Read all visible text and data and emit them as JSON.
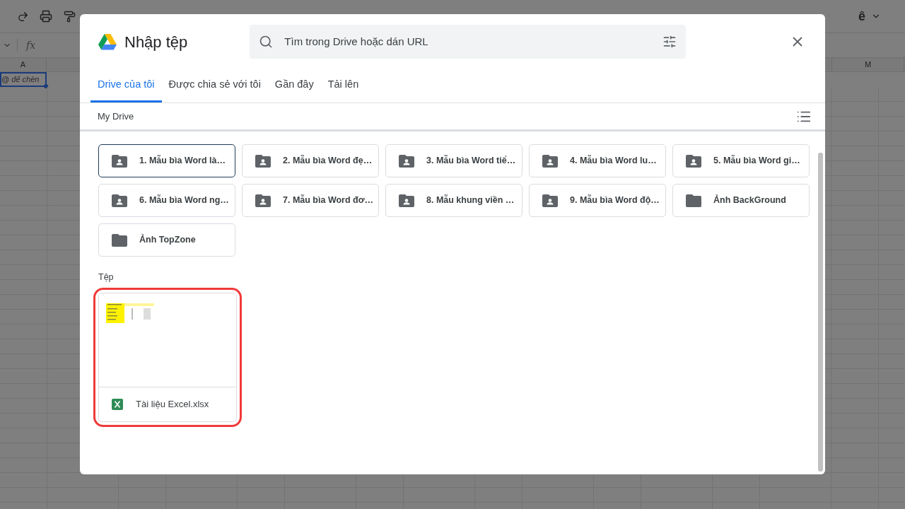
{
  "spreadsheet": {
    "formula_label": "fx",
    "columns": [
      {
        "label": "A"
      },
      {
        "label": "M"
      }
    ],
    "cell_a1": "@ để chèn",
    "toolbar_right": [
      "ê"
    ]
  },
  "dialog": {
    "title": "Nhập tệp",
    "search": {
      "placeholder": "Tìm trong Drive hoặc dán URL"
    },
    "tabs": [
      {
        "label": "Drive của tôi",
        "selected": true
      },
      {
        "label": "Được chia sẻ với tôi",
        "selected": false
      },
      {
        "label": "Gần đây",
        "selected": false
      },
      {
        "label": "Tải lên",
        "selected": false
      }
    ],
    "breadcrumb": "My Drive",
    "folders": [
      {
        "name": "1. Mẫu bìa Word là…",
        "kind": "shared",
        "selected": true
      },
      {
        "name": "2. Mẫu bìa Word đẹ…",
        "kind": "shared",
        "selected": false
      },
      {
        "name": "3. Mẫu bìa Word tiể…",
        "kind": "shared",
        "selected": false
      },
      {
        "name": "4. Mẫu bìa Word lu…",
        "kind": "shared",
        "selected": false
      },
      {
        "name": "5. Mẫu bìa Word gi…",
        "kind": "shared",
        "selected": false
      },
      {
        "name": "6. Mẫu bìa Word ng…",
        "kind": "shared",
        "selected": false
      },
      {
        "name": "7. Mẫu bìa Word đơ…",
        "kind": "shared",
        "selected": false
      },
      {
        "name": "8. Mẫu khung viền …",
        "kind": "shared",
        "selected": false
      },
      {
        "name": "9. Mẫu bìa Word độ…",
        "kind": "shared",
        "selected": false
      },
      {
        "name": "Ảnh BackGround",
        "kind": "folder",
        "selected": false
      },
      {
        "name": "Ảnh TopZone",
        "kind": "folder",
        "selected": false
      }
    ],
    "files_heading": "Tệp",
    "files": [
      {
        "name": "Tài liệu Excel.xlsx",
        "kind": "picture",
        "highlighted": true
      }
    ]
  }
}
